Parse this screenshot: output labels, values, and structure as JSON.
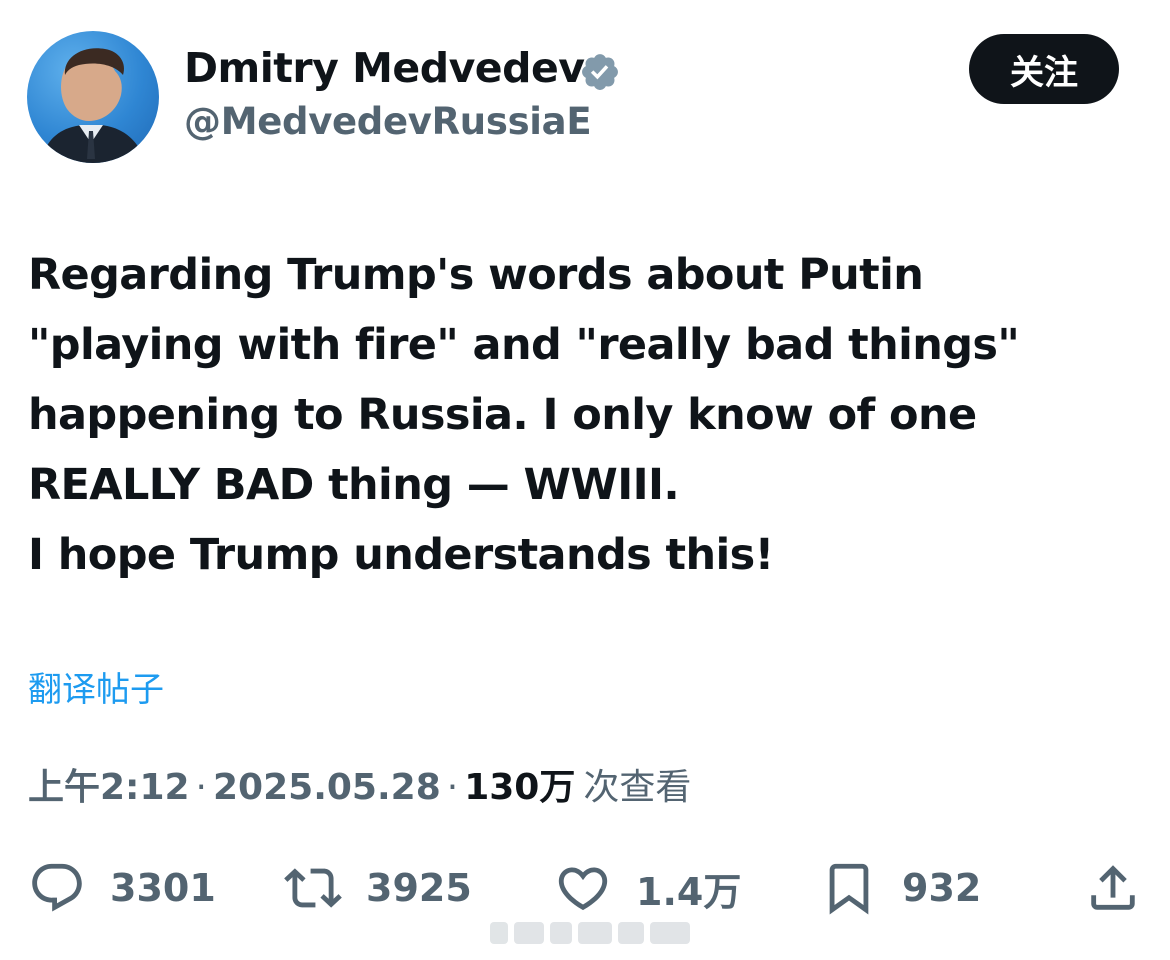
{
  "author": {
    "display_name": "Dmitry Medvedev",
    "handle": "@MedvedevRussiaE",
    "verified": true,
    "avatar_icon": "profile-photo"
  },
  "follow_button": {
    "label": "关注"
  },
  "post": {
    "lines": [
      "Regarding Trump's words about Putin",
      "\"playing with fire\" and \"really bad things\"",
      "happening to Russia. I only know of one",
      "REALLY BAD thing — WWIII.",
      "I hope Trump understands this!"
    ]
  },
  "translate_link": {
    "label": "翻译帖子"
  },
  "meta": {
    "time": "上午2:12",
    "separator": "·",
    "date": "2025.05.28",
    "views_count": "130万",
    "views_label": "次查看"
  },
  "actions": {
    "reply": {
      "icon": "reply-icon",
      "count": "3301"
    },
    "retweet": {
      "icon": "retweet-icon",
      "count": "3925"
    },
    "like": {
      "icon": "heart-icon",
      "count": "1.4万"
    },
    "bookmark": {
      "icon": "bookmark-icon",
      "count": "932"
    },
    "share": {
      "icon": "share-icon"
    }
  },
  "colors": {
    "text_primary": "#0f1419",
    "text_secondary": "#536471",
    "link": "#1d9bf0",
    "verified_badge": "#829aab",
    "button_bg": "#0f1419"
  }
}
